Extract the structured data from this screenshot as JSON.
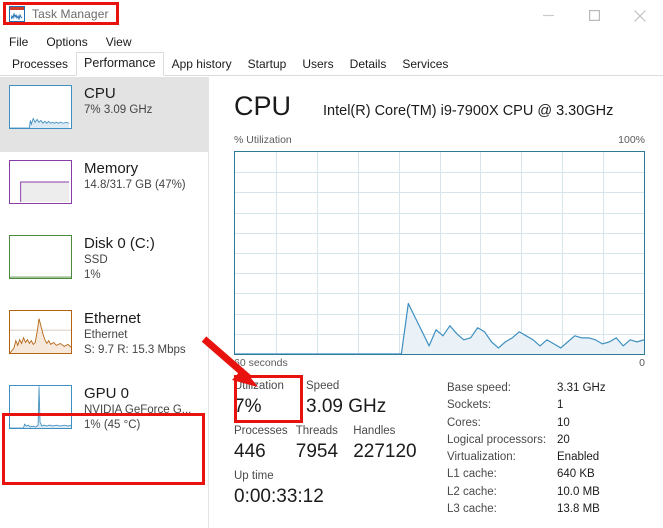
{
  "window": {
    "title": "Task Manager",
    "icon": "task-manager-icon",
    "controls": [
      {
        "name": "minimize-button",
        "glyph": "minimize"
      },
      {
        "name": "maximize-button",
        "glyph": "maximize"
      },
      {
        "name": "close-button",
        "glyph": "close"
      }
    ]
  },
  "menu": {
    "items": [
      {
        "label": "File"
      },
      {
        "label": "Options"
      },
      {
        "label": "View"
      }
    ]
  },
  "tabs": {
    "active": "Performance",
    "items": [
      {
        "label": "Processes"
      },
      {
        "label": "Performance"
      },
      {
        "label": "App history"
      },
      {
        "label": "Startup"
      },
      {
        "label": "Users"
      },
      {
        "label": "Details"
      },
      {
        "label": "Services"
      }
    ]
  },
  "sidebar": {
    "items": [
      {
        "name": "cpu",
        "title": "CPU",
        "sub1": "7% 3.09 GHz",
        "sub2": "",
        "selected": true,
        "color": "#3f8fc0",
        "highlighted": false
      },
      {
        "name": "memory",
        "title": "Memory",
        "sub1": "14.8/31.7 GB (47%)",
        "sub2": "",
        "selected": false,
        "color": "#883ca6",
        "highlighted": false
      },
      {
        "name": "disk-0-c",
        "title": "Disk 0 (C:)",
        "sub1": "SSD",
        "sub2": "1%",
        "selected": false,
        "color": "#4b8a3c",
        "highlighted": false
      },
      {
        "name": "ethernet",
        "title": "Ethernet",
        "sub1": "Ethernet",
        "sub2": "S: 9.7 R: 15.3 Mbps",
        "selected": false,
        "color": "#b4620f",
        "highlighted": false
      },
      {
        "name": "gpu-0",
        "title": "GPU 0",
        "sub1": "NVIDIA GeForce G...",
        "sub2": "1%  (45 °C)",
        "selected": false,
        "color": "#3f8fc0",
        "highlighted": true
      }
    ]
  },
  "main": {
    "title": "CPU",
    "model": "Intel(R) Core(TM) i9-7900X CPU @ 3.30GHz",
    "axis_left": "% Utilization",
    "axis_right": "100%",
    "time_left": "60 seconds",
    "time_right": "0"
  },
  "stats": {
    "utilization": {
      "label": "Utilization",
      "value": "7%"
    },
    "speed": {
      "label": "Speed",
      "value": "3.09 GHz"
    },
    "processes": {
      "label": "Processes",
      "value": "446"
    },
    "threads": {
      "label": "Threads",
      "value": "7954"
    },
    "handles": {
      "label": "Handles",
      "value": "227120"
    },
    "uptime": {
      "label": "Up time",
      "value": "0:00:33:12"
    }
  },
  "specs": [
    {
      "key": "Base speed:",
      "value": "3.31 GHz"
    },
    {
      "key": "Sockets:",
      "value": "1"
    },
    {
      "key": "Cores:",
      "value": "10"
    },
    {
      "key": "Logical processors:",
      "value": "20"
    },
    {
      "key": "Virtualization:",
      "value": "Enabled"
    },
    {
      "key": "L1 cache:",
      "value": "640 KB"
    },
    {
      "key": "L2 cache:",
      "value": "10.0 MB"
    },
    {
      "key": "L3 cache:",
      "value": "13.8 MB"
    }
  ],
  "annotations": {
    "highlight_color": "#e8130e",
    "boxes": [
      "title-bar-task-manager",
      "sidebar-gpu-0",
      "stat-utilization"
    ],
    "arrow": "gpu-0-to-utilization"
  },
  "chart_data": {
    "type": "area",
    "title": "CPU % Utilization",
    "xlabel": "",
    "ylabel": "% Utilization",
    "ylim": [
      0,
      100
    ],
    "xlim": [
      60,
      0
    ],
    "x_tick_labels": [
      "60 seconds",
      "0"
    ],
    "y_tick_labels": [
      "100%"
    ],
    "grid": true,
    "grid_cols": 10,
    "grid_rows": 10,
    "line_color": "#3f8fc0",
    "fill_color": "#eaf2f8",
    "series": [
      {
        "name": "CPU utilization",
        "values": [
          0,
          0,
          0,
          0,
          0,
          0,
          0,
          0,
          0,
          0,
          0,
          0,
          0,
          0,
          0,
          0,
          0,
          0,
          0,
          0,
          0,
          0,
          0,
          0,
          0,
          25,
          18,
          11,
          4,
          12,
          9,
          14,
          10,
          7,
          8,
          13,
          11,
          6,
          3,
          6,
          8,
          11,
          9,
          7,
          4,
          7,
          5,
          3,
          6,
          9,
          8,
          8,
          7,
          5,
          6,
          8,
          4,
          7,
          6,
          7
        ]
      }
    ]
  }
}
